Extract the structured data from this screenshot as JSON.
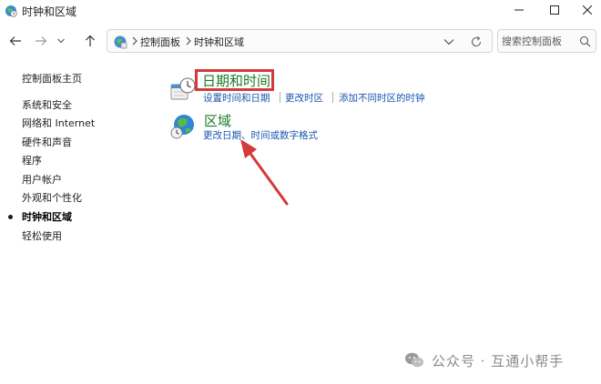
{
  "window": {
    "title": "时钟和区域",
    "icons": {
      "app": "clock-globe-icon",
      "minimize": "minimize-icon",
      "maximize": "maximize-icon",
      "close": "close-icon"
    }
  },
  "nav": {
    "icons": {
      "back": "back-arrow-icon",
      "forward": "forward-arrow-icon",
      "recent": "chevron-down-icon",
      "up": "up-arrow-icon"
    }
  },
  "address": {
    "breadcrumbs": [
      "控制面板",
      "时钟和区域"
    ],
    "icons": {
      "location": "control-panel-icon",
      "dropdown": "chevron-down-icon",
      "refresh": "refresh-icon"
    }
  },
  "search": {
    "placeholder": "搜索控制面板",
    "value": "",
    "icon": "search-icon"
  },
  "sidebar": {
    "items": [
      {
        "label": "控制面板主页",
        "active": false
      },
      {
        "label": "系统和安全",
        "active": false
      },
      {
        "label": "网络和 Internet",
        "active": false
      },
      {
        "label": "硬件和声音",
        "active": false
      },
      {
        "label": "程序",
        "active": false
      },
      {
        "label": "用户帐户",
        "active": false
      },
      {
        "label": "外观和个性化",
        "active": false
      },
      {
        "label": "时钟和区域",
        "active": true
      },
      {
        "label": "轻松使用",
        "active": false
      }
    ]
  },
  "main": {
    "categories": [
      {
        "title": "日期和时间",
        "icon": "date-time-clock-icon",
        "links": [
          "设置时间和日期",
          "更改时区",
          "添加不同时区的时钟"
        ]
      },
      {
        "title": "区域",
        "icon": "region-globe-icon",
        "links": [
          "更改日期、时间或数字格式"
        ]
      }
    ]
  },
  "annotation": {
    "highlight_color": "#d43a3a",
    "arrow_color": "#d43a3a"
  },
  "watermark": {
    "text": "公众号 · 互通小帮手",
    "icon": "wechat-logo-icon"
  },
  "colors": {
    "category_title": "#1a7a24",
    "link": "#1a55b0"
  }
}
